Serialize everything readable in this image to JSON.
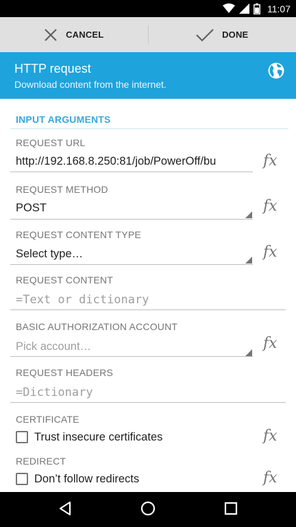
{
  "status_bar": {
    "time": "11:07",
    "icons": [
      "wifi-icon",
      "signal-icon",
      "battery-icon"
    ]
  },
  "action_bar": {
    "cancel_label": "CANCEL",
    "done_label": "DONE"
  },
  "header": {
    "title": "HTTP request",
    "subtitle": "Download content from the internet.",
    "icon": "globe-icon",
    "color": "#1ea3dc"
  },
  "form": {
    "section_title": "INPUT ARGUMENTS",
    "request_url": {
      "label": "REQUEST URL",
      "value": "http://192.168.8.250:81/job/PowerOff/bu"
    },
    "request_method": {
      "label": "REQUEST METHOD",
      "value": "POST"
    },
    "request_content_type": {
      "label": "REQUEST CONTENT TYPE",
      "value": "Select type…"
    },
    "request_content": {
      "label": "REQUEST CONTENT",
      "prefix": "=",
      "placeholder": "Text or dictionary"
    },
    "basic_auth": {
      "label": "BASIC AUTHORIZATION ACCOUNT",
      "placeholder": "Pick account…"
    },
    "request_headers": {
      "label": "REQUEST HEADERS",
      "prefix": "=",
      "placeholder": "Dictionary"
    },
    "certificate": {
      "label": "CERTIFICATE",
      "checkbox_label": "Trust insecure certificates",
      "checked": false
    },
    "redirect": {
      "label": "REDIRECT",
      "checkbox_label": "Don’t follow redirects",
      "checked": false
    }
  },
  "nav_bar": {
    "buttons": [
      "back-icon",
      "home-icon",
      "recents-icon"
    ]
  },
  "colors": {
    "accent": "#33a9de",
    "header_bg": "#1ea3dc",
    "action_bar_bg": "#e0e0e0"
  }
}
